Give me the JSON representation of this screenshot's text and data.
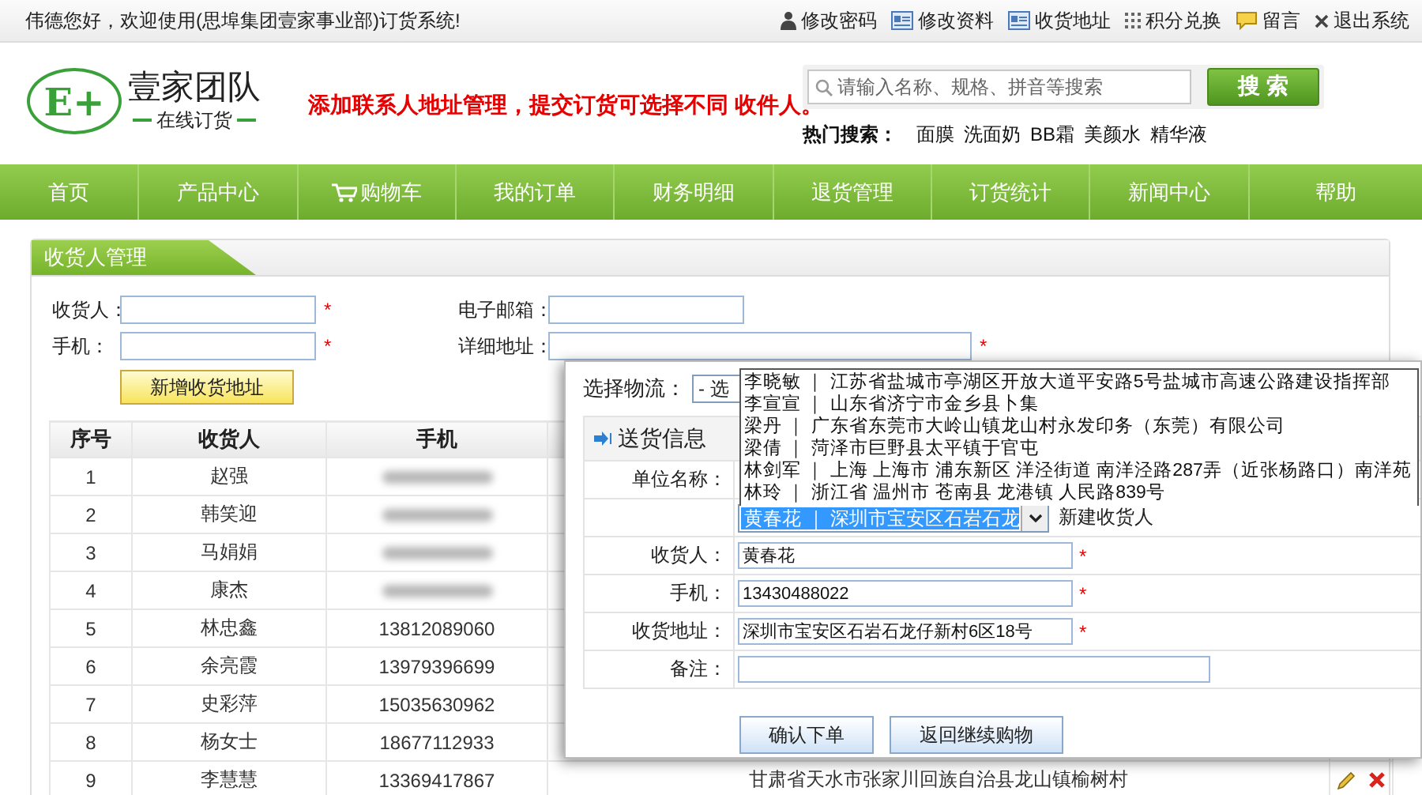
{
  "top_bar": {
    "greeting": "伟德您好，欢迎使用(思埠集团壹家事业部)订货系统!",
    "links": [
      {
        "kind": "password",
        "label": "修改密码"
      },
      {
        "kind": "profile",
        "label": "修改资料"
      },
      {
        "kind": "address",
        "label": "收货地址"
      },
      {
        "kind": "points",
        "label": "积分兑换"
      },
      {
        "kind": "message",
        "label": "留言"
      },
      {
        "kind": "logout",
        "label": "退出系统"
      }
    ]
  },
  "header": {
    "logo": {
      "mark": "E+",
      "name": "壹家团队",
      "tagline": "在线订货"
    },
    "notice": "添加联系人地址管理，提交订货可选择不同 收件人。",
    "search": {
      "placeholder": "请输入名称、规格、拼音等搜索",
      "button": "搜 索"
    },
    "hot_search": {
      "label": "热门搜索：",
      "keywords": [
        "面膜",
        "洗面奶",
        "BB霜",
        "美颜水",
        "精华液"
      ]
    }
  },
  "nav": [
    {
      "kind": "link",
      "label": "首页"
    },
    {
      "kind": "link",
      "label": "产品中心"
    },
    {
      "kind": "cart",
      "label": "购物车"
    },
    {
      "kind": "link",
      "label": "我的订单"
    },
    {
      "kind": "link",
      "label": "财务明细"
    },
    {
      "kind": "link",
      "label": "退货管理"
    },
    {
      "kind": "link",
      "label": "订货统计"
    },
    {
      "kind": "link",
      "label": "新闻中心"
    },
    {
      "kind": "link",
      "label": "帮助"
    }
  ],
  "panel": {
    "title": "收货人管理",
    "form": {
      "fields": [
        {
          "label": "收货人：",
          "required_mark": "*"
        },
        {
          "label": "电子邮箱："
        },
        {
          "label": "手机：",
          "required_mark": "*"
        },
        {
          "label": "详细地址：",
          "required_mark": "*"
        }
      ],
      "submit": "新增收货地址"
    },
    "table": {
      "columns": [
        "序号",
        "收货人",
        "手机"
      ],
      "rows": [
        {
          "index": "1",
          "name": "赵强",
          "phone_blurred": true
        },
        {
          "index": "2",
          "name": "韩笑迎",
          "phone_blurred": true
        },
        {
          "index": "3",
          "name": "马娟娟",
          "phone_blurred": true
        },
        {
          "index": "4",
          "name": "康杰",
          "phone_blurred": true
        },
        {
          "index": "5",
          "name": "林忠鑫",
          "phone": "13812089060",
          "phone_blurred": false
        },
        {
          "index": "6",
          "name": "余亮霞",
          "phone": "13979396699",
          "phone_blurred": false
        },
        {
          "index": "7",
          "name": "史彩萍",
          "phone": "15035630962",
          "phone_blurred": false
        },
        {
          "index": "8",
          "name": "杨女士",
          "phone": "18677112933",
          "phone_blurred": false
        },
        {
          "index": "9",
          "name": "李慧慧",
          "phone": "13369417867",
          "phone_blurred": false,
          "column_4": "甘肃省天水市张家川回族自治县龙山镇榆树村",
          "actions": true
        }
      ]
    }
  },
  "dialog": {
    "logistics": {
      "label": "选择物流：",
      "value": "- 选"
    },
    "section_title": "送货信息",
    "company_label": "单位名称：",
    "consignee_select": {
      "value": "黄春花 ｜ 深圳市宝安区石岩石龙",
      "expanded": true,
      "options": [
        {
          "label": "李晓敏 ｜ 江苏省盐城市亭湖区开放大道平安路5号盐城市高速公路建设指挥部",
          "selected": false
        },
        {
          "label": "李宣宣 ｜ 山东省济宁市金乡县卜集",
          "selected": false
        },
        {
          "label": "梁丹 ｜ 广东省东莞市大岭山镇龙山村永发印务（东莞）有限公司",
          "selected": false
        },
        {
          "label": "梁倩 ｜ 菏泽市巨野县太平镇于官屯",
          "selected": false
        },
        {
          "label": "林剑军 ｜ 上海 上海市 浦东新区 洋泾街道 南洋泾路287弄（近张杨路口）南洋苑",
          "selected": false
        },
        {
          "label": "林玲 ｜ 浙江省 温州市 苍南县 龙港镇 人民路839号",
          "selected": false
        }
      ]
    },
    "new_consignee": "新建收货人",
    "fields": [
      {
        "label": "收货人：",
        "value": "黄春花",
        "required_mark": "*"
      },
      {
        "label": "手机：",
        "value": "13430488022",
        "required_mark": "*"
      },
      {
        "label": "收货地址：",
        "value": "深圳市宝安区石岩石龙仔新村6区18号",
        "required_mark": "*"
      },
      {
        "label": "备注："
      }
    ],
    "buttons": [
      "确认下单",
      "返回继续购物"
    ]
  }
}
